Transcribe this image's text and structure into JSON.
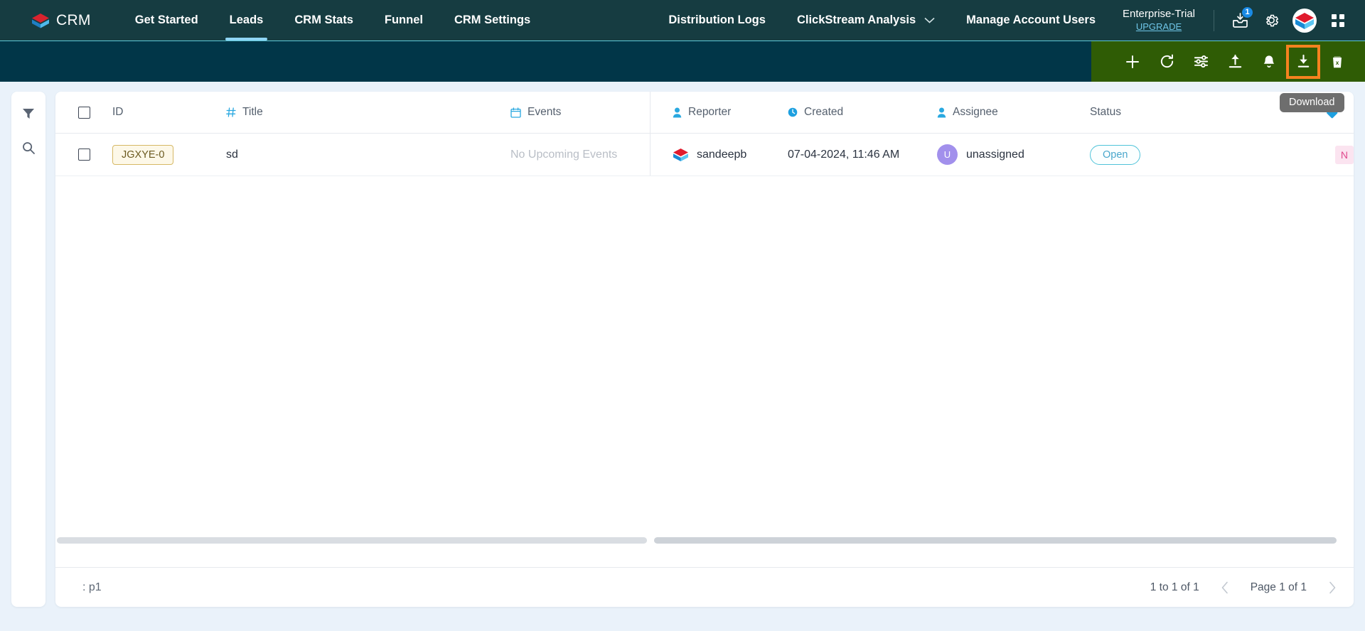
{
  "app": {
    "brand": "CRM",
    "brand_logo_icon": "stacked-layers-logo"
  },
  "topnav": {
    "items": [
      {
        "label": "Get Started",
        "active": false
      },
      {
        "label": "Leads",
        "active": true
      },
      {
        "label": "CRM Stats",
        "active": false
      },
      {
        "label": "Funnel",
        "active": false
      },
      {
        "label": "CRM Settings",
        "active": false
      }
    ],
    "right_items": [
      {
        "label": "Distribution Logs",
        "has_caret": false
      },
      {
        "label": "ClickStream Analysis",
        "has_caret": true
      },
      {
        "label": "Manage Account Users",
        "has_caret": false
      }
    ],
    "plan": {
      "name": "Enterprise-Trial",
      "upgrade_label": "UPGRADE"
    },
    "icons": [
      {
        "name": "inbox-download-icon",
        "badge": "1"
      },
      {
        "name": "gear-icon",
        "badge": ""
      },
      {
        "name": "product-logo-icon",
        "badge": ""
      },
      {
        "name": "apps-grid-icon",
        "badge": ""
      }
    ]
  },
  "toolbar": {
    "buttons": [
      {
        "name": "add-icon",
        "label": "Add",
        "highlighted": false
      },
      {
        "name": "refresh-icon",
        "label": "Refresh",
        "highlighted": false
      },
      {
        "name": "settings-sliders-icon",
        "label": "Settings",
        "highlighted": false
      },
      {
        "name": "upload-icon",
        "label": "Upload",
        "highlighted": false
      },
      {
        "name": "bell-icon",
        "label": "Notifications",
        "highlighted": false
      },
      {
        "name": "download-icon",
        "label": "Download",
        "highlighted": true
      },
      {
        "name": "delete-icon",
        "label": "Delete",
        "highlighted": false
      }
    ],
    "tooltip": "Download",
    "highlight_color": "#f5821f",
    "bar_color": "#2f5c05"
  },
  "rail": {
    "buttons": [
      {
        "name": "filter-icon",
        "label": "Filter"
      },
      {
        "name": "search-icon",
        "label": "Search"
      }
    ]
  },
  "table": {
    "columns": [
      {
        "key": "select",
        "label": "",
        "icon": ""
      },
      {
        "key": "id",
        "label": "ID",
        "icon": ""
      },
      {
        "key": "title",
        "label": "Title",
        "icon": "hash-icon"
      },
      {
        "key": "events",
        "label": "Events",
        "icon": "calendar-icon"
      },
      {
        "key": "reporter",
        "label": "Reporter",
        "icon": "person-icon"
      },
      {
        "key": "created",
        "label": "Created",
        "icon": "clock-icon"
      },
      {
        "key": "assignee",
        "label": "Assignee",
        "icon": "person-icon"
      },
      {
        "key": "status",
        "label": "Status",
        "icon": ""
      },
      {
        "key": "tags",
        "label": "",
        "icon": "tag-icon"
      }
    ],
    "rows": [
      {
        "id": "JGXYE-0",
        "title": "sd",
        "events": "No Upcoming Events",
        "reporter": "sandeepb",
        "reporter_icon": "stacked-layers-logo",
        "created": "07-04-2024, 11:46 AM",
        "assignee": "unassigned",
        "assignee_initial": "U",
        "status": "Open",
        "tag": "N"
      }
    ]
  },
  "footer": {
    "left_label": ": p1",
    "range_label": "1 to 1 of 1",
    "page_label": "Page 1 of 1",
    "prev_icon": "chevron-left-icon",
    "next_icon": "chevron-right-icon"
  }
}
